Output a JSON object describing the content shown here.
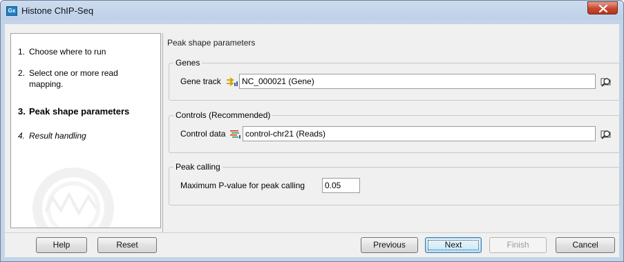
{
  "window": {
    "title": "Histone ChIP-Seq",
    "app_icon_text": "Gx"
  },
  "steps": [
    {
      "number": "1.",
      "label": "Choose where to run"
    },
    {
      "number": "2.",
      "label_line1": "Select one or more read",
      "label_line2": "mapping."
    },
    {
      "number": "3.",
      "label": "Peak shape parameters"
    },
    {
      "number": "4.",
      "label": "Result handling"
    }
  ],
  "content": {
    "section_title": "Peak shape parameters",
    "genes": {
      "legend": "Genes",
      "label": "Gene track",
      "value": "NC_000021 (Gene)"
    },
    "controls": {
      "legend": "Controls (Recommended)",
      "label": "Control data",
      "value": "control-chr21 (Reads)"
    },
    "peak_calling": {
      "legend": "Peak calling",
      "label": "Maximum P-value for peak calling",
      "value": "0.05"
    }
  },
  "buttons": {
    "help": "Help",
    "reset": "Reset",
    "previous": "Previous",
    "next": "Next",
    "finish": "Finish",
    "cancel": "Cancel"
  },
  "icons": {
    "app": "gx-app-icon",
    "close": "close-icon",
    "gene_track": "gene-track-icon",
    "reads": "reads-track-icon",
    "browse": "browse-folder-icon"
  },
  "colors": {
    "window_frame": "#c4d4e7",
    "close_button": "#c7472f",
    "next_button_border": "#3c7fb1"
  }
}
